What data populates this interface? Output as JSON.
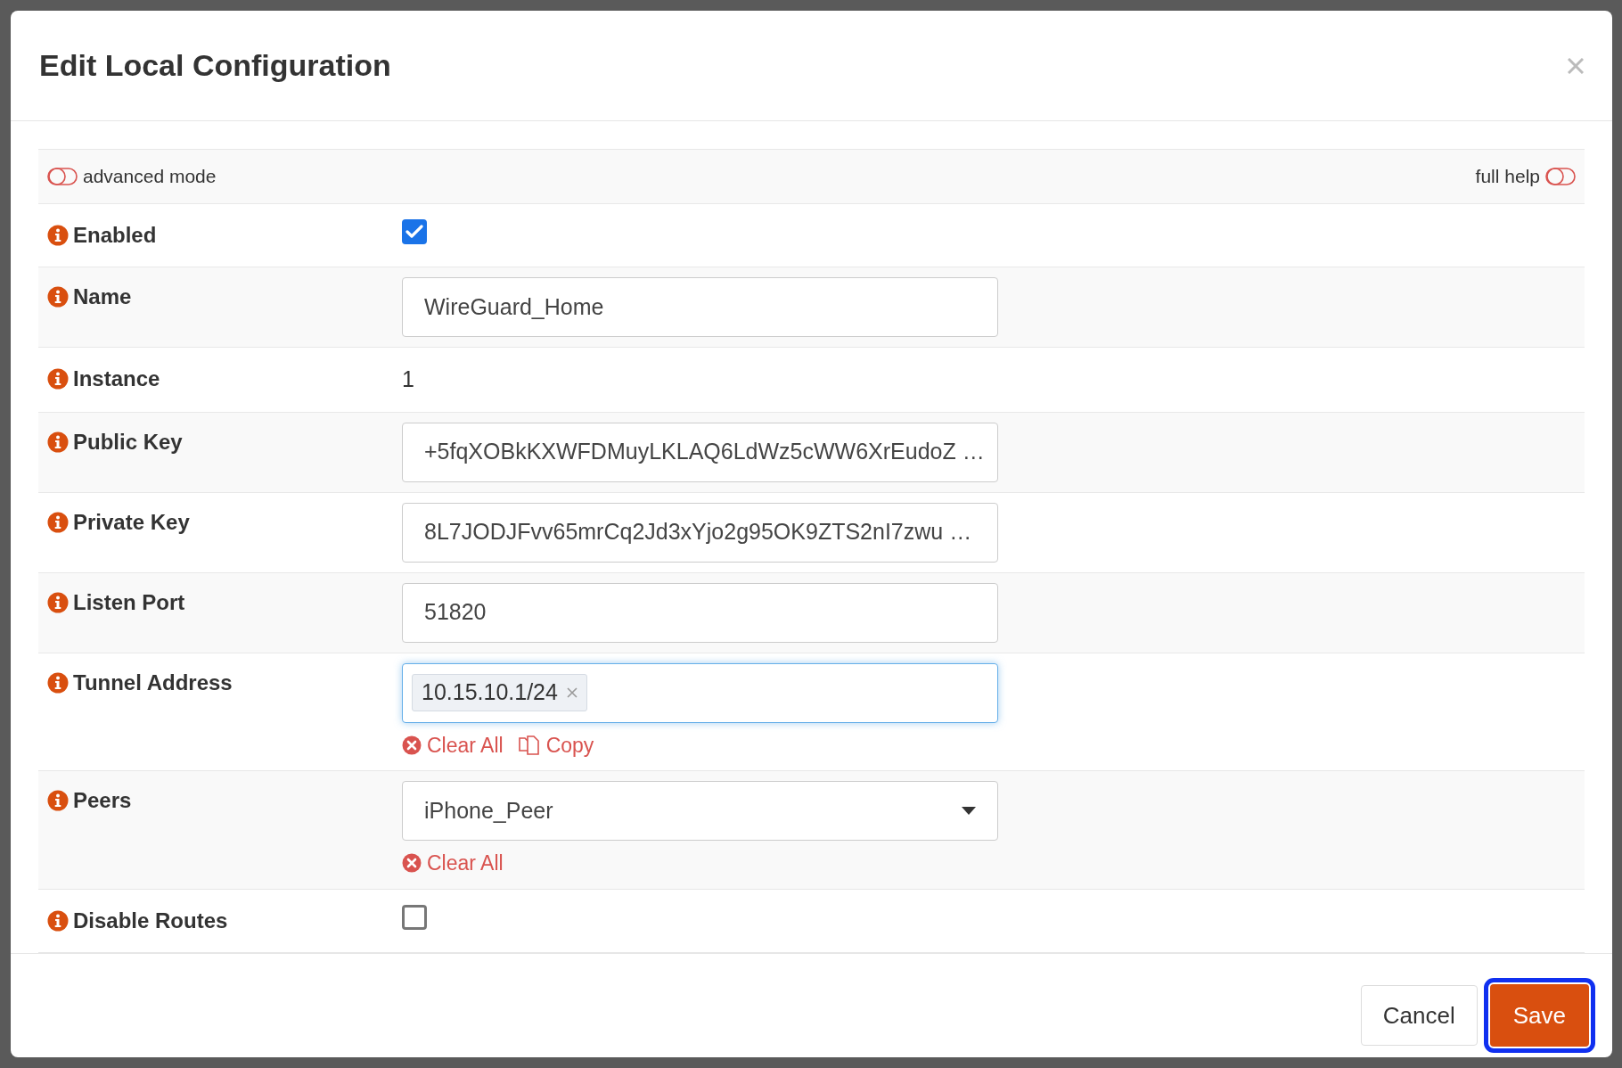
{
  "dialog": {
    "title": "Edit Local Configuration",
    "toggles": [
      {
        "label": "advanced mode",
        "on": false
      },
      {
        "label": "full help",
        "on": false
      }
    ],
    "fields": [
      {
        "kind": "checkbox",
        "label": "Enabled",
        "checked": true
      },
      {
        "kind": "text",
        "label": "Name",
        "value": "WireGuard_Home"
      },
      {
        "kind": "static",
        "label": "Instance",
        "value": "1"
      },
      {
        "kind": "text",
        "label": "Public Key",
        "value": "+5fqXOBkKXWFDMuyLKLAQ6LdWz5cWW6XrEudoZ …"
      },
      {
        "kind": "text",
        "label": "Private Key",
        "value": "8L7JODJFvv65mrCq2Jd3xYjo2g95OK9ZTS2nI7zwu …"
      },
      {
        "kind": "text",
        "label": "Listen Port",
        "value": "51820"
      },
      {
        "kind": "tags",
        "label": "Tunnel Address",
        "tags": [
          "10.15.10.1/24"
        ],
        "focused": true,
        "actions": [
          {
            "kind": "clear",
            "label": "Clear All"
          },
          {
            "kind": "copy",
            "label": "Copy"
          }
        ]
      },
      {
        "kind": "select",
        "label": "Peers",
        "value": "iPhone_Peer",
        "actions": [
          {
            "kind": "clear",
            "label": "Clear All"
          }
        ]
      },
      {
        "kind": "checkbox",
        "label": "Disable Routes",
        "checked": false
      }
    ],
    "buttons": [
      {
        "kind": "secondary",
        "label": "Cancel",
        "focused": false
      },
      {
        "kind": "primary",
        "label": "Save",
        "focused": true
      }
    ]
  }
}
